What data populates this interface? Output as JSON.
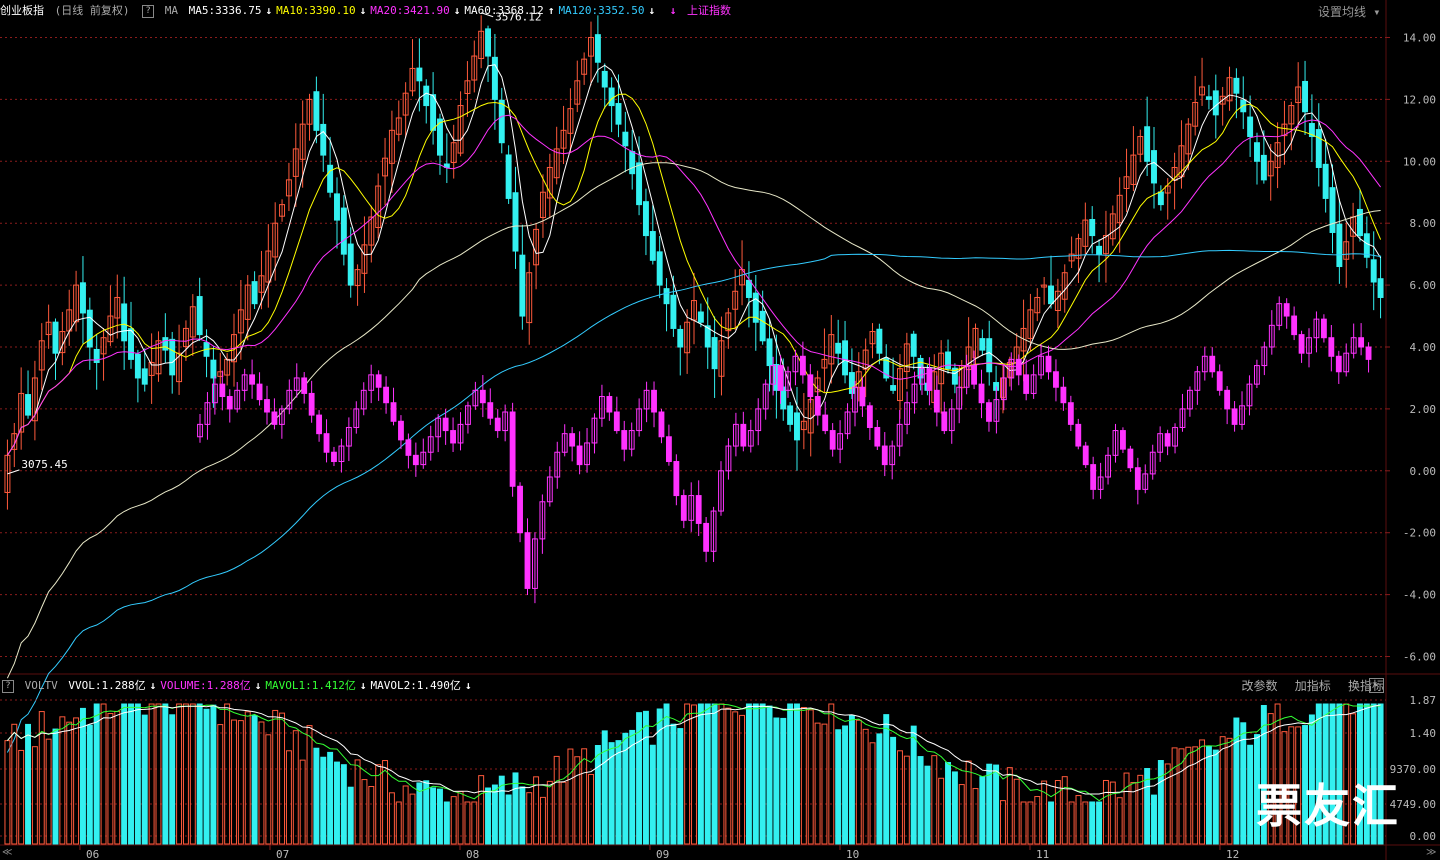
{
  "header": {
    "title": "创业板指",
    "period": "(日线 前复权)",
    "question_mark": "?",
    "ma_label": "MA",
    "ma_items": [
      {
        "text": "MA5:3336.75",
        "arrow": "↓",
        "color": "#ffffff",
        "arrow_color": "#ffffff"
      },
      {
        "text": "MA10:3390.10",
        "arrow": "↓",
        "color": "#ffff00",
        "arrow_color": "#ffffff"
      },
      {
        "text": "MA20:3421.90",
        "arrow": "↓",
        "color": "#ff33ff",
        "arrow_color": "#ffffff"
      },
      {
        "text": "MA60:3368.12",
        "arrow": "↑",
        "color": "#ffffff",
        "arrow_color": "#ffffff"
      },
      {
        "text": "MA120:3352.50",
        "arrow": "↓",
        "color": "#33ccff",
        "arrow_color": "#ffffff"
      }
    ],
    "compare": {
      "arrow": "↓",
      "text": "上证指数",
      "color": "#ff33ff"
    },
    "settings": "设置均线"
  },
  "volume_header": {
    "question_mark": "?",
    "label": "VOLTV",
    "items": [
      {
        "text": "VVOL:1.288亿",
        "arrow": "↓",
        "color": "#ffffff"
      },
      {
        "text": "VOLUME:1.288亿",
        "arrow": "↓",
        "color": "#ff33ff"
      },
      {
        "text": "MAVOL1:1.412亿",
        "arrow": "↓",
        "color": "#33ff33"
      },
      {
        "text": "MAVOL2:1.490亿",
        "arrow": "↓",
        "color": "#ffffff"
      }
    ],
    "buttons": [
      "改参数",
      "加指标",
      "换指标"
    ],
    "close": "×"
  },
  "watermark": "票友汇",
  "nav_left": "≪",
  "nav_right": "≫",
  "colors": {
    "up": "#ff5a3c",
    "down": "#33f0f0",
    "compare": "#ff33ff",
    "grid": "#8a1c1c"
  },
  "chart_data": [
    {
      "type": "candlestick",
      "title": "创业板指",
      "x_tick_labels": [
        "06",
        "07",
        "08",
        "09",
        "10",
        "11",
        "12"
      ],
      "y_ticks_right": [
        "14.00",
        "12.00",
        "10.00",
        "8.00",
        "6.00",
        "4.00",
        "2.00",
        "0.00",
        "-2.00",
        "-4.00",
        "-6.00"
      ],
      "ylim_pct": [
        -6.5,
        14.5
      ],
      "annotations": [
        {
          "text": "3576.12",
          "type": "high"
        },
        {
          "text": "3075.45",
          "type": "low"
        }
      ],
      "close_pct_series": [
        0.5,
        1.2,
        2.5,
        1.8,
        3.0,
        4.2,
        4.8,
        3.8,
        4.5,
        5.2,
        6.0,
        5.1,
        4.0,
        3.5,
        4.3,
        5.0,
        5.6,
        4.2,
        3.6,
        3.0,
        2.8,
        3.5,
        4.2,
        3.9,
        3.1,
        3.8,
        4.6,
        5.3,
        4.4,
        3.7,
        3.0,
        3.2,
        3.6,
        4.4,
        5.2,
        6.0,
        5.4,
        6.3,
        7.1,
        8.0,
        8.6,
        9.4,
        10.4,
        11.2,
        12.0,
        11.0,
        10.2,
        9.0,
        8.1,
        7.0,
        6.0,
        6.5,
        7.3,
        8.2,
        9.2,
        10.1,
        11.0,
        11.4,
        12.2,
        13.0,
        12.6,
        11.8,
        11.0,
        10.2,
        9.8,
        10.6,
        11.8,
        12.6,
        13.4,
        14.2,
        13.4,
        12.0,
        10.6,
        8.8,
        7.1,
        5.0,
        6.4,
        7.8,
        9.0,
        9.8,
        10.4,
        11.0,
        11.7,
        12.6,
        13.3,
        14.0,
        13.2,
        12.4,
        11.8,
        11.2,
        10.5,
        9.6,
        8.6,
        7.6,
        6.8,
        6.0,
        5.4,
        4.6,
        4.0,
        4.8,
        5.5,
        4.8,
        4.0,
        3.3,
        4.2,
        5.1,
        5.8,
        6.5,
        5.6,
        4.8,
        4.2,
        3.4,
        2.6,
        2.0,
        1.5,
        1.0,
        1.6,
        2.3,
        3.0,
        3.6,
        4.4,
        3.8,
        3.1,
        2.5,
        3.2,
        3.9,
        4.5,
        3.8,
        3.0,
        2.6,
        3.3,
        4.1,
        3.7,
        3.0,
        2.6,
        3.2,
        3.8,
        3.3,
        2.8,
        3.4,
        4.0,
        4.6,
        3.9,
        3.2,
        2.6,
        3.0,
        3.5,
        4.0,
        4.6,
        5.2,
        5.6,
        6.0,
        5.4,
        5.8,
        6.4,
        7.0,
        7.5,
        8.1,
        7.6,
        7.0,
        7.6,
        8.3,
        8.9,
        9.5,
        10.2,
        10.8,
        10.0,
        9.3,
        8.6,
        9.2,
        9.8,
        10.5,
        11.2,
        11.9,
        12.4,
        12.0,
        11.5,
        12.1,
        12.7,
        12.2,
        11.6,
        10.8,
        10.0,
        9.4,
        10.0,
        10.6,
        11.2,
        11.8,
        12.4,
        11.6,
        10.8,
        9.8,
        8.8,
        7.7,
        6.6,
        7.4,
        8.2,
        7.6,
        6.9,
        6.1,
        5.6
      ]
    },
    {
      "type": "line",
      "series": [
        {
          "name": "上证指数",
          "color": "#ff33ff"
        }
      ],
      "close_pct_series": [
        1.5,
        2.2,
        2.8,
        2.4,
        2.0,
        2.6,
        3.1,
        2.8,
        2.3,
        1.9,
        1.5,
        2.0,
        2.6,
        3.0,
        2.5,
        1.8,
        1.2,
        0.6,
        0.3,
        0.8,
        1.4,
        2.0,
        2.6,
        3.1,
        2.7,
        2.2,
        1.6,
        1.0,
        0.5,
        0.2,
        0.6,
        1.1,
        1.7,
        1.3,
        0.9,
        1.5,
        2.1,
        2.6,
        2.2,
        1.7,
        1.3,
        1.9,
        -0.5,
        -2.0,
        -3.8,
        -2.2,
        -1.0,
        -0.2,
        0.6,
        1.2,
        0.8,
        0.2,
        0.9,
        1.7,
        2.4,
        1.9,
        1.3,
        0.7,
        1.3,
        2.0,
        2.6,
        1.9,
        1.1,
        0.3,
        -0.8,
        -1.6,
        -0.8,
        -1.7,
        -2.6,
        -1.3,
        0.0,
        0.8,
        1.5,
        0.8,
        1.3,
        2.0,
        2.8,
        3.4,
        2.6,
        3.2,
        3.7,
        3.1,
        2.4,
        1.8,
        1.3,
        0.7,
        1.2,
        1.9,
        2.7,
        2.1,
        1.4,
        0.8,
        0.2,
        0.8,
        1.5,
        2.2,
        2.8,
        3.3,
        2.6,
        1.9,
        1.3,
        2.0,
        2.7,
        3.4,
        2.8,
        2.2,
        1.6,
        2.3,
        3.0,
        3.6,
        3.1,
        2.5,
        3.1,
        3.7,
        3.2,
        2.7,
        2.2,
        1.5,
        0.8,
        0.2,
        -0.6,
        -0.2,
        0.5,
        1.3,
        0.7,
        0.1,
        -0.6,
        -0.1,
        0.6,
        1.2,
        0.8,
        1.4,
        2.0,
        2.6,
        3.2,
        3.7,
        3.2,
        2.6,
        2.0,
        1.5,
        2.1,
        2.8,
        3.4,
        4.0,
        4.7,
        5.4,
        5.0,
        4.4,
        3.8,
        4.3,
        4.9,
        4.3,
        3.7,
        3.2,
        3.8,
        4.3,
        4.0,
        3.6
      ]
    },
    {
      "type": "bar",
      "title": "VOLTV",
      "y_ticks_right": [
        "1.87",
        "1.40",
        "9370.00",
        "4749.00",
        "0.00"
      ],
      "series": [
        {
          "name": "VOLUME",
          "color": "#ff33ff"
        },
        {
          "name": "MAVOL1",
          "color": "#33ff33"
        },
        {
          "name": "MAVOL2",
          "color": "#ffffff"
        }
      ]
    }
  ]
}
